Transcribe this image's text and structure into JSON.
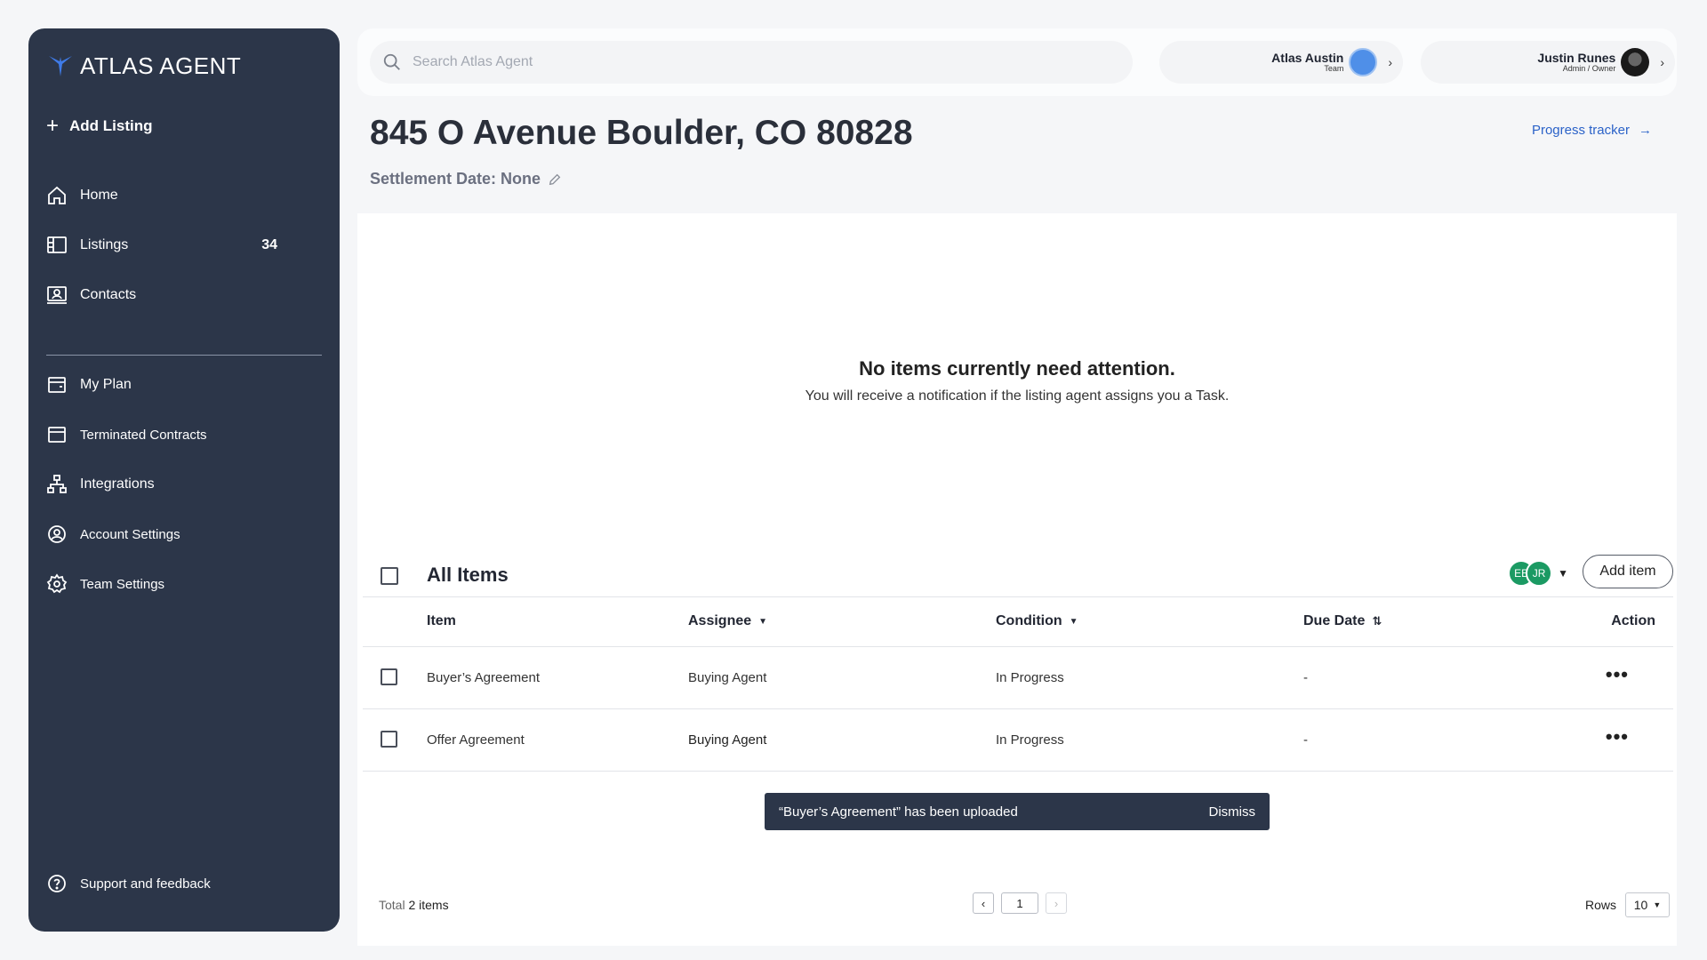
{
  "sidebar": {
    "brand": "ATLAS AGENT",
    "add_listing": "Add Listing",
    "items": [
      {
        "label": "Home"
      },
      {
        "label": "Listings",
        "count": "34"
      },
      {
        "label": "Contacts"
      }
    ],
    "items2": [
      {
        "label": "My Plan"
      },
      {
        "label": "Terminated Contracts"
      },
      {
        "label": "Integrations"
      },
      {
        "label": "Account Settings"
      },
      {
        "label": "Team Settings"
      }
    ],
    "support": "Support and feedback"
  },
  "topbar": {
    "search_placeholder": "Search Atlas Agent",
    "team": {
      "name": "Atlas Austin",
      "sub": "Team"
    },
    "user": {
      "name": "Justin Runes",
      "sub": "Admin / Owner"
    }
  },
  "page": {
    "title": "845 O Avenue Boulder, CO 80828",
    "settlement": "Settlement Date: None",
    "progress_tracker": "Progress tracker"
  },
  "empty": {
    "title": "No items currently need attention.",
    "subtitle": "You will receive a notification if the listing agent assigns you a Task."
  },
  "items": {
    "title": "All Items",
    "assignees": [
      "EE",
      "JR"
    ],
    "add_item": "Add item",
    "columns": {
      "item": "Item",
      "assignee": "Assignee",
      "condition": "Condition",
      "due": "Due Date",
      "action": "Action"
    },
    "rows": [
      {
        "item": "Buyer’s Agreement",
        "assignee": "Buying Agent",
        "condition": "In Progress",
        "due": "-"
      },
      {
        "item": "Offer Agreement",
        "assignee": "Buying Agent",
        "condition": "In Progress",
        "due": "-"
      }
    ]
  },
  "toast": {
    "message": "“Buyer’s Agreement” has been uploaded",
    "dismiss": "Dismiss"
  },
  "footer": {
    "total_label": "Total",
    "total_value": "2 items",
    "page": "1",
    "rows_label": "Rows",
    "rows_value": "10"
  },
  "colors": {
    "sidebar": "#2c3649",
    "accent_link": "#2b62c8",
    "avatar": "#1b9a63"
  }
}
